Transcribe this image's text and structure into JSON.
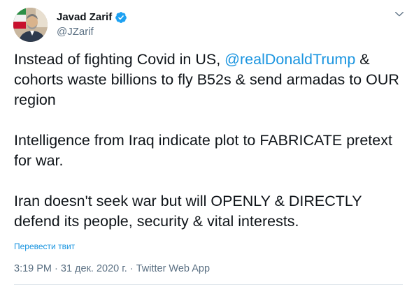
{
  "author": {
    "display_name": "Javad Zarif",
    "handle": "@JZarif",
    "verified_icon": "verified-badge-icon",
    "avatar_icon": "profile-photo"
  },
  "menu": {
    "icon": "more-chevron-down-icon"
  },
  "tweet": {
    "p1_before": "Instead of fighting Covid in US, ",
    "p1_mention": "@realDonaldTrump",
    "p1_after": " & cohorts waste billions to fly B52s & send armadas to OUR region",
    "p2": "Intelligence from Iraq indicate plot to FABRICATE pretext for war.",
    "p3": "Iran doesn't seek war but will OPENLY & DIRECTLY defend its people, security & vital interests."
  },
  "translate_label": "Перевести твит",
  "meta": {
    "time": "3:19 PM",
    "separator1": " · ",
    "date": "31 дек. 2020 г.",
    "separator2": " · ",
    "source": "Twitter Web App"
  },
  "colors": {
    "link": "#1b95e0",
    "secondary_text": "#5b7083",
    "primary_text": "#0f1419",
    "verified": "#1da1f2"
  }
}
